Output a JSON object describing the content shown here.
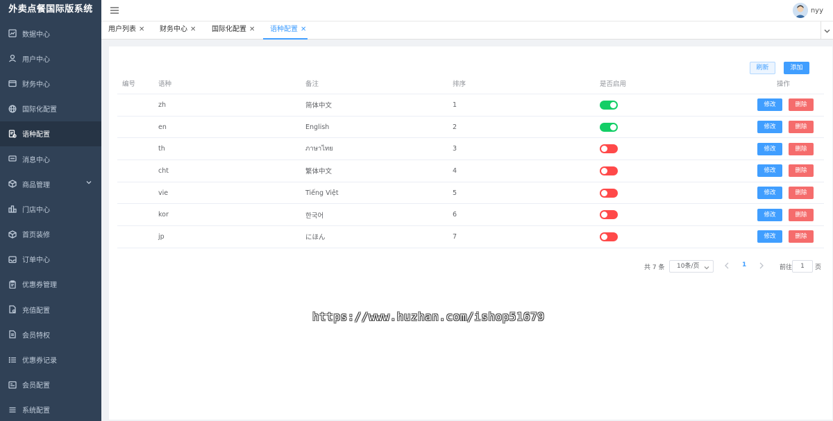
{
  "app": {
    "title": "外卖点餐国际版系统"
  },
  "sidebar": {
    "items": [
      {
        "label": "数据中心",
        "icon": "chart-icon"
      },
      {
        "label": "用户中心",
        "icon": "user-icon"
      },
      {
        "label": "财务中心",
        "icon": "wallet-icon"
      },
      {
        "label": "国际化配置",
        "icon": "globe-icon"
      },
      {
        "label": "语种配置",
        "icon": "language-icon",
        "active": true
      },
      {
        "label": "消息中心",
        "icon": "message-icon"
      },
      {
        "label": "商品管理",
        "icon": "box-icon",
        "expandable": true
      },
      {
        "label": "门店中心",
        "icon": "store-icon"
      },
      {
        "label": "首页装修",
        "icon": "cube-icon"
      },
      {
        "label": "订单中心",
        "icon": "inbox-icon"
      },
      {
        "label": "优惠券管理",
        "icon": "clipboard-icon"
      },
      {
        "label": "充值配置",
        "icon": "document-icon"
      },
      {
        "label": "会员特权",
        "icon": "file-icon"
      },
      {
        "label": "优惠券记录",
        "icon": "list-icon"
      },
      {
        "label": "会员配置",
        "icon": "form-icon"
      },
      {
        "label": "系统配置",
        "icon": "menu-icon"
      }
    ]
  },
  "header": {
    "username": "nyy"
  },
  "tabs": [
    {
      "label": "用户列表",
      "active": false
    },
    {
      "label": "财务中心",
      "active": false
    },
    {
      "label": "国际化配置",
      "active": false
    },
    {
      "label": "语种配置",
      "active": true
    }
  ],
  "toolbar": {
    "refresh_label": "刷新",
    "add_label": "添加"
  },
  "table": {
    "columns": {
      "id": "编号",
      "lang": "语种",
      "note": "备注",
      "sort": "排序",
      "enabled": "是否启用",
      "ops": "操作"
    },
    "rows": [
      {
        "id": "",
        "lang": "zh",
        "note": "简体中文",
        "sort": "1",
        "enabled": true
      },
      {
        "id": "",
        "lang": "en",
        "note": "English",
        "sort": "2",
        "enabled": true
      },
      {
        "id": "",
        "lang": "th",
        "note": "ภาษาไทย",
        "sort": "3",
        "enabled": false
      },
      {
        "id": "",
        "lang": "cht",
        "note": "繁体中文",
        "sort": "4",
        "enabled": false
      },
      {
        "id": "",
        "lang": "vie",
        "note": "Tiếng Việt",
        "sort": "5",
        "enabled": false
      },
      {
        "id": "",
        "lang": "kor",
        "note": "한국어",
        "sort": "6",
        "enabled": false
      },
      {
        "id": "",
        "lang": "jp",
        "note": "にほん",
        "sort": "7",
        "enabled": false
      }
    ],
    "edit_label": "修改",
    "delete_label": "删除"
  },
  "pagination": {
    "total_text": "共 7 条",
    "page_size": "10条/页",
    "current_page": "1",
    "goto_label": "前往",
    "goto_value": "1",
    "page_suffix": "页"
  },
  "watermark": {
    "text": "https://www.huzhan.com/ishop51679"
  },
  "colors": {
    "primary": "#409eff",
    "danger": "#f56c6c",
    "switch_on": "#13ce66",
    "switch_off": "#ff4949",
    "sidebar_bg": "#304156"
  }
}
